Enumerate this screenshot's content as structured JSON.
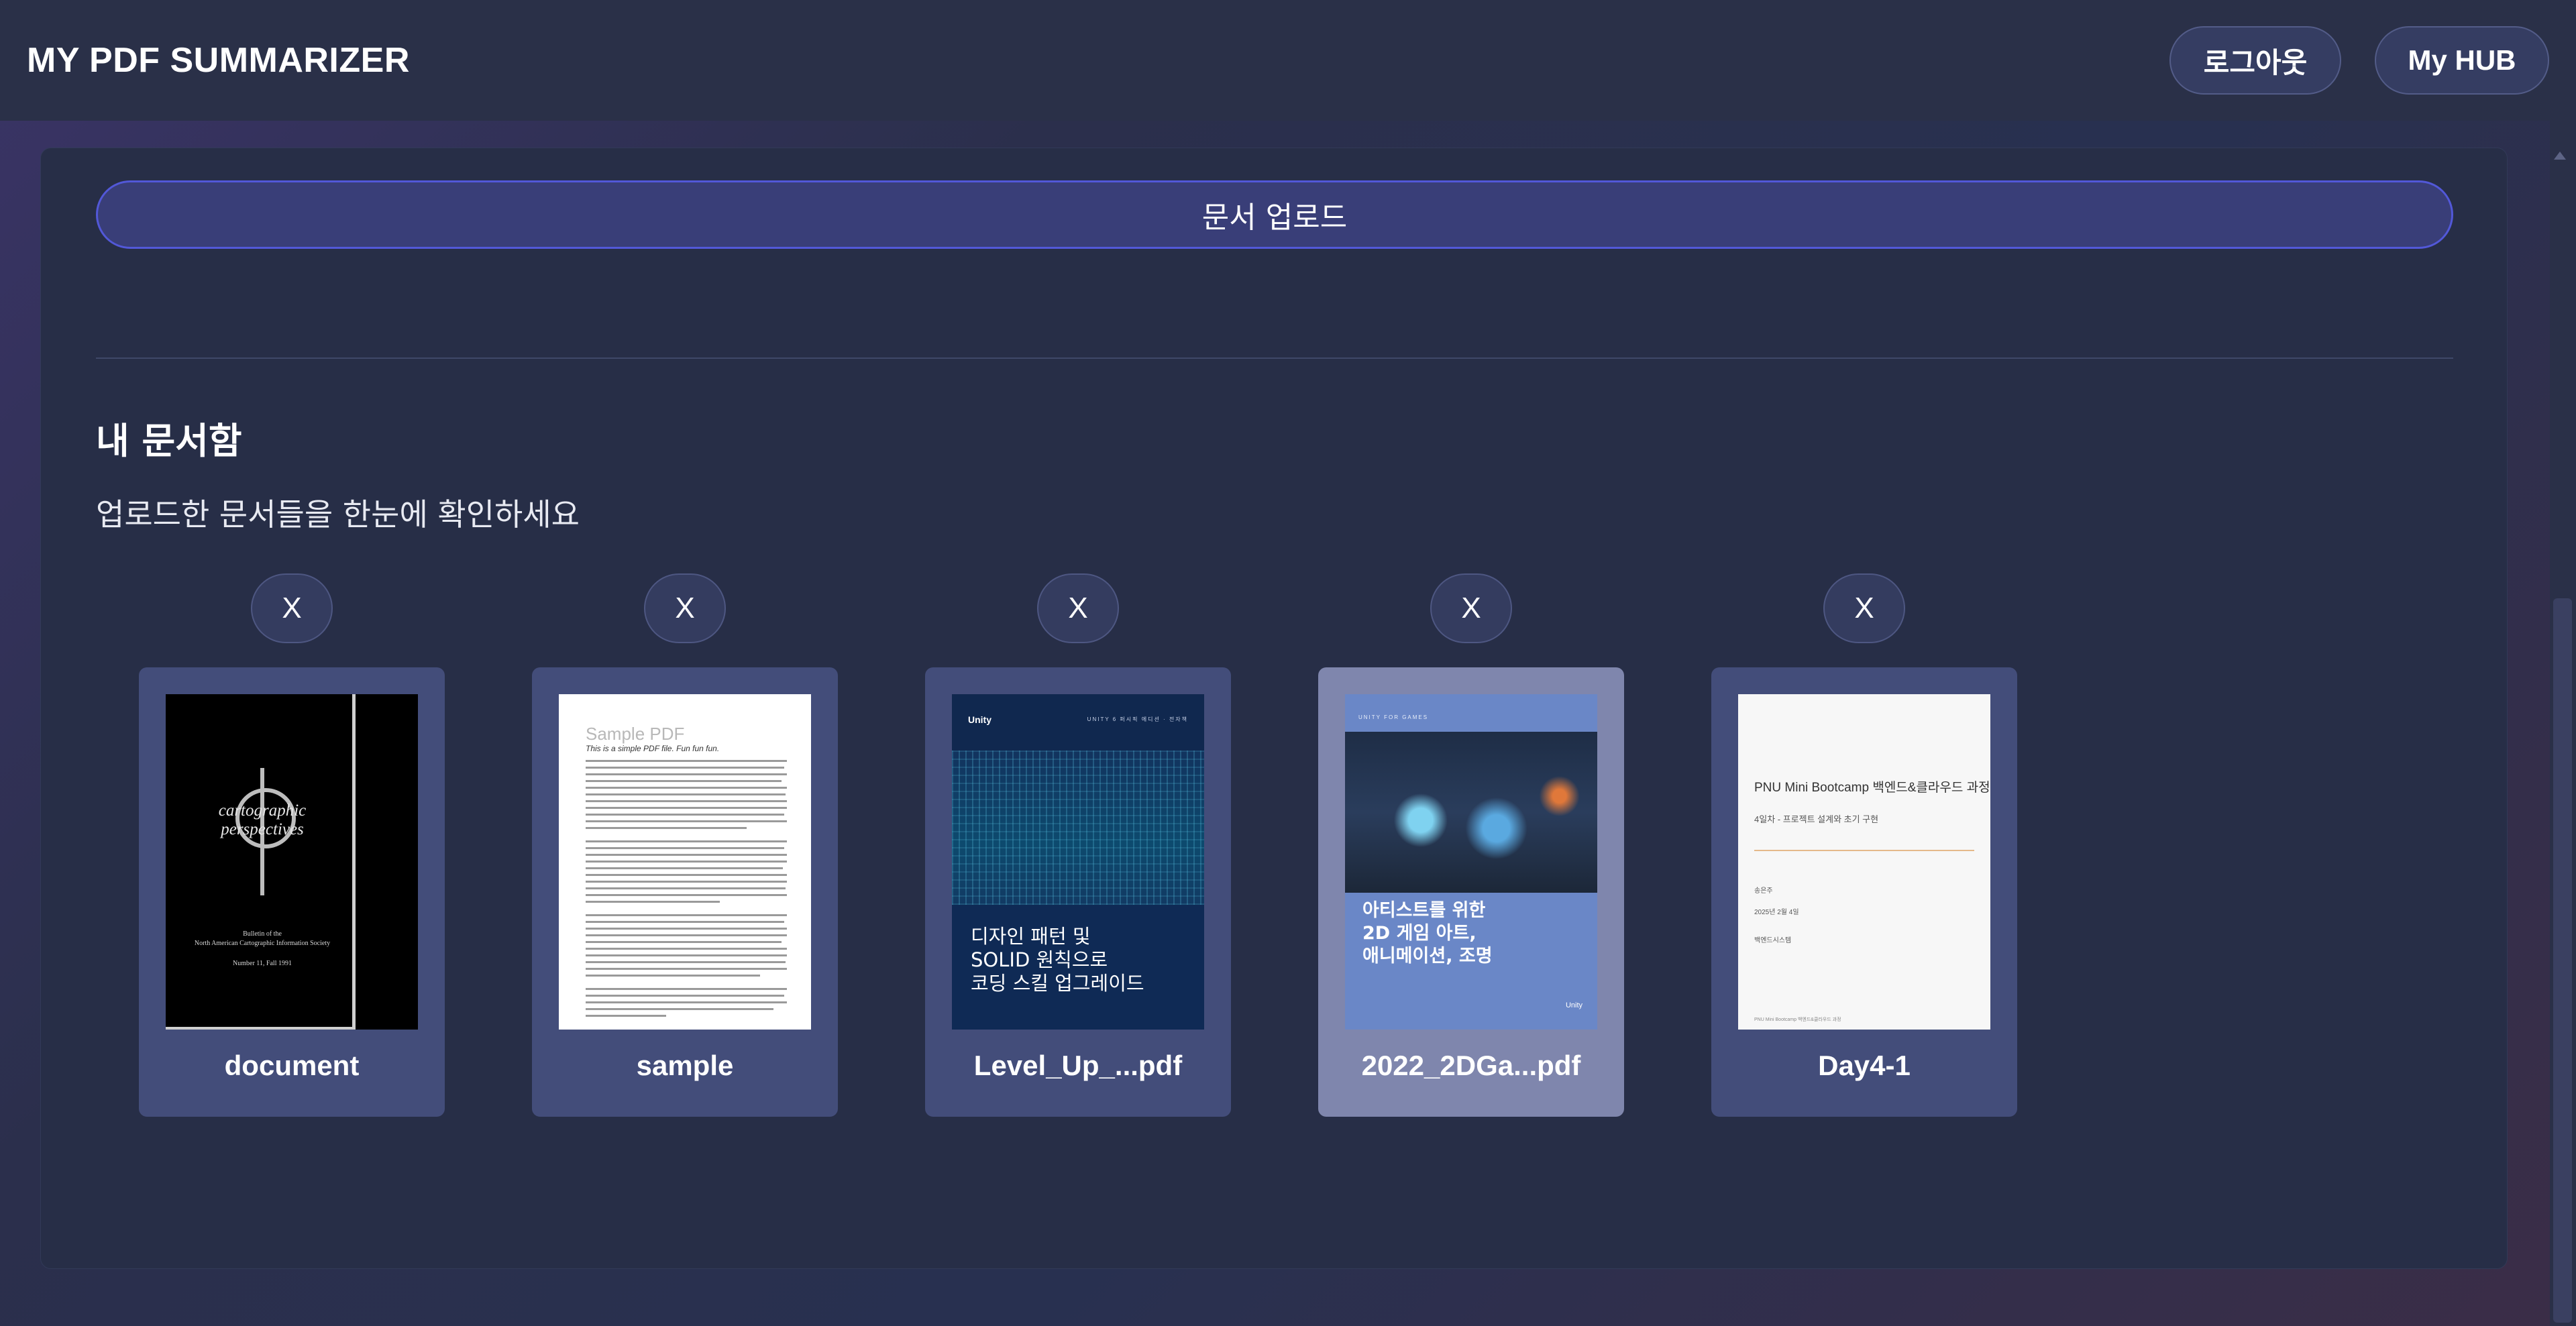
{
  "header": {
    "brand": "MY PDF SUMMARIZER",
    "logout_label": "로그아웃",
    "hub_label": "My HUB"
  },
  "upload": {
    "label": "문서 업로드"
  },
  "section": {
    "title": "내 문서함",
    "subtitle": "업로드한 문서들을 한눈에 확인하세요"
  },
  "documents": [
    {
      "name": "document",
      "delete_label": "X",
      "selected": false,
      "thumb": {
        "title": "cartographic perspectives",
        "line1": "Bulletin of the",
        "line2": "North American Cartographic Information Society",
        "line3": "Number 11, Fall 1991"
      }
    },
    {
      "name": "sample",
      "delete_label": "X",
      "selected": false,
      "thumb": {
        "title": "Sample PDF",
        "subtitle": "This is a simple PDF file. Fun fun fun."
      }
    },
    {
      "name": "Level_Up_...pdf",
      "delete_label": "X",
      "selected": false,
      "thumb": {
        "brand": "Unity",
        "header": "UNITY 6 퍼시픽 에디션 · 전자책",
        "title_l1": "디자인 패턴 및",
        "title_l2": "SOLID 원칙으로",
        "title_l3": "코딩 스킬 업그레이드"
      }
    },
    {
      "name": "2022_2DGa...pdf",
      "delete_label": "X",
      "selected": true,
      "thumb": {
        "header": "UNITY FOR GAMES",
        "title_l1": "아티스트를 위한",
        "title_l2": "2D 게임 아트,",
        "title_l3": "애니메이션, 조명",
        "brand": "Unity"
      }
    },
    {
      "name": "Day4-1",
      "delete_label": "X",
      "selected": false,
      "thumb": {
        "title": "PNU Mini Bootcamp 백엔드&클라우드 과정",
        "subtitle": "4일차 - 프로젝트 설계와 초기 구현",
        "meta1": "송은주",
        "meta2": "2025년 2월 4일",
        "meta3": "백엔드시스템",
        "footer": "PNU Mini Bootcamp 백엔드&클라우드 과정"
      }
    }
  ]
}
